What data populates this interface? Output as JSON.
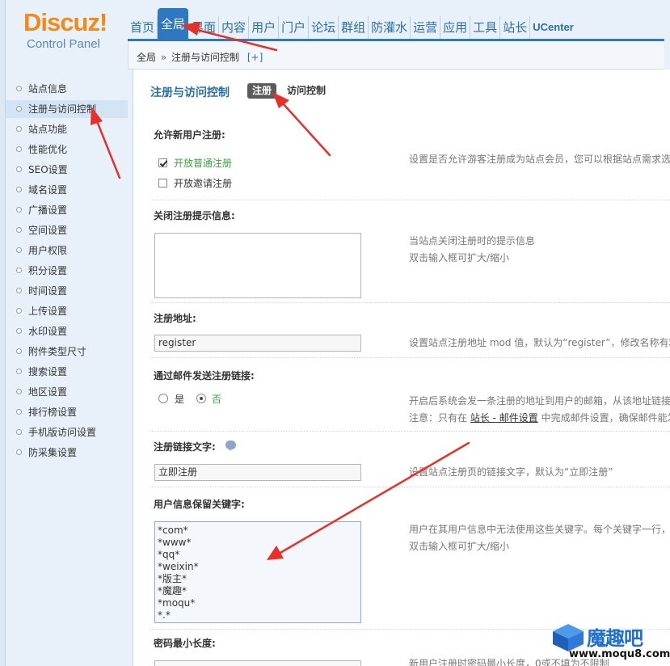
{
  "logo": {
    "brand": "Discuz",
    "bang": "!",
    "subtitle": "Control Panel"
  },
  "topnav": {
    "tabs": [
      "首页",
      "全局",
      "界面",
      "内容",
      "用户",
      "门户",
      "论坛",
      "群组",
      "防灌水",
      "运营",
      "应用",
      "工具",
      "站长",
      "UCenter"
    ],
    "active": "全局"
  },
  "breadcrumb": {
    "root": "全局",
    "sep": "»",
    "current": "注册与访问控制",
    "add": "[+]"
  },
  "sidebar": {
    "items": [
      "站点信息",
      "注册与访问控制",
      "站点功能",
      "性能优化",
      "SEO设置",
      "域名设置",
      "广播设置",
      "空间设置",
      "用户权限",
      "积分设置",
      "时间设置",
      "上传设置",
      "水印设置",
      "附件类型尺寸",
      "搜索设置",
      "地区设置",
      "排行榜设置",
      "手机版访问设置",
      "防采集设置"
    ],
    "active_index": 1
  },
  "main": {
    "title": "注册与访问控制",
    "subtabs": {
      "active": "注册",
      "other": "访问控制"
    },
    "allow_register": {
      "label": "允许新用户注册:",
      "opt1": "开放普通注册",
      "opt2": "开放邀请注册",
      "opt1_checked": true,
      "opt2_checked": false,
      "tip": "设置是否允许游客注册成为站点会员，您可以根据站点需求选"
    },
    "close_msg": {
      "label": "关闭注册提示信息:",
      "tip1": "当站点关闭注册时的提示信息",
      "tip2": "双击输入框可扩大/缩小"
    },
    "reg_url": {
      "label": "注册地址:",
      "value": "register",
      "tip": "设置站点注册地址 mod 值，默认为“register”，修改名称有利"
    },
    "email_link": {
      "label": "通过邮件发送注册链接:",
      "yes": "是",
      "no": "否",
      "selected": "否",
      "tip1": "开启后系统会发一条注册的地址到用户的邮箱，从该地址链接",
      "tip2_pre": "注意：只有在 ",
      "tip2_link": "站长 - 邮件设置",
      "tip2_post": " 中完成邮件设置，确保邮件能发"
    },
    "link_text": {
      "label": "注册链接文字:",
      "value": "立即注册",
      "tip": "设置站点注册页的链接文字，默认为“立即注册”"
    },
    "censor": {
      "label": "用户信息保留关键字:",
      "keywords": [
        "*com*",
        "*www*",
        "*qq*",
        "*weixin*",
        "*版主*",
        "*魔趣*",
        "*moqu*",
        "*.*"
      ],
      "tip1": "用户在其用户信息中无法使用这些关键字。每个关键字一行，",
      "tip2": "双击输入框可扩大/缩小"
    },
    "pwd_len": {
      "label": "密码最小长度:",
      "tip": "新用户注册时密码最小长度，0或不填为不限制"
    }
  },
  "watermark": {
    "title": "魔趣吧",
    "url": "www.moqu8.com"
  },
  "colors": {
    "accent": "#2e78c2",
    "logo_orange": "#f08a1a",
    "arrow_red": "#e8302a",
    "sidebar_bg": "#e8f1f9"
  }
}
